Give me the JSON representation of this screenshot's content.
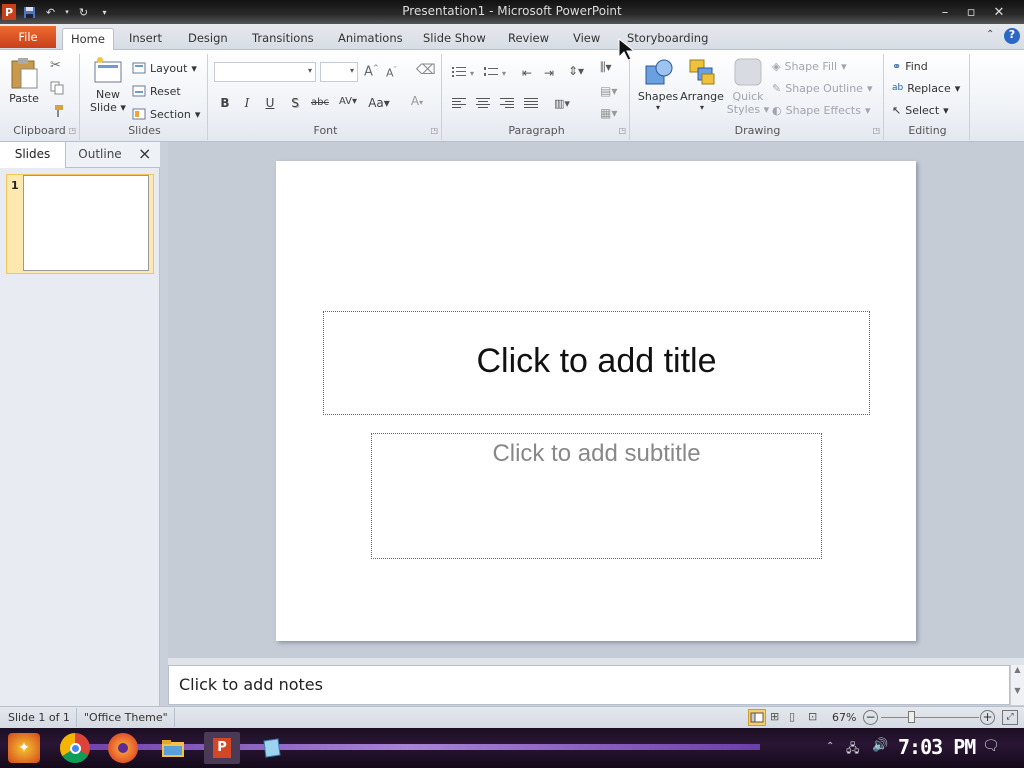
{
  "app": {
    "title": "Presentation1 - Microsoft PowerPoint",
    "app_logo_letter": "P"
  },
  "ribbon_tabs": [
    "File",
    "Home",
    "Insert",
    "Design",
    "Transitions",
    "Animations",
    "Slide Show",
    "Review",
    "View",
    "Storyboarding"
  ],
  "groups": {
    "clipboard": {
      "label": "Clipboard",
      "paste": "Paste"
    },
    "slides": {
      "label": "Slides",
      "new_slide": "New",
      "new_slide2": "Slide",
      "layout": "Layout",
      "reset": "Reset",
      "section": "Section"
    },
    "font": {
      "label": "Font",
      "grow": "A",
      "shrink": "A",
      "bold": "B",
      "italic": "I",
      "underline": "U",
      "shadow": "S",
      "strike": "abc",
      "spacing": "AV",
      "case": "Aa",
      "color": "A"
    },
    "paragraph": {
      "label": "Paragraph"
    },
    "drawing": {
      "label": "Drawing",
      "shapes": "Shapes",
      "arrange": "Arrange",
      "quick_styles1": "Quick",
      "quick_styles2": "Styles",
      "shape_fill": "Shape Fill",
      "shape_outline": "Shape Outline",
      "shape_effects": "Shape Effects"
    },
    "editing": {
      "label": "Editing",
      "find": "Find",
      "replace": "Replace",
      "select": "Select"
    }
  },
  "left_pane": {
    "tab_slides": "Slides",
    "tab_outline": "Outline",
    "close": "×",
    "slide_number": "1"
  },
  "slide": {
    "title_placeholder": "Click to add title",
    "subtitle_placeholder": "Click to add subtitle"
  },
  "notes": {
    "placeholder": "Click to add notes"
  },
  "statusbar": {
    "slide_info": "Slide 1 of 1",
    "theme": "\"Office Theme\"",
    "zoom": "67%",
    "zoom_level_percent": 67
  },
  "taskbar": {
    "time": "7:03 PM"
  },
  "colors": {
    "file_tab": "#d4502a",
    "ribbon_bg": "#eef1f6",
    "thumb_highlight": "#fde9b0",
    "taskbar": "#1f1027"
  }
}
